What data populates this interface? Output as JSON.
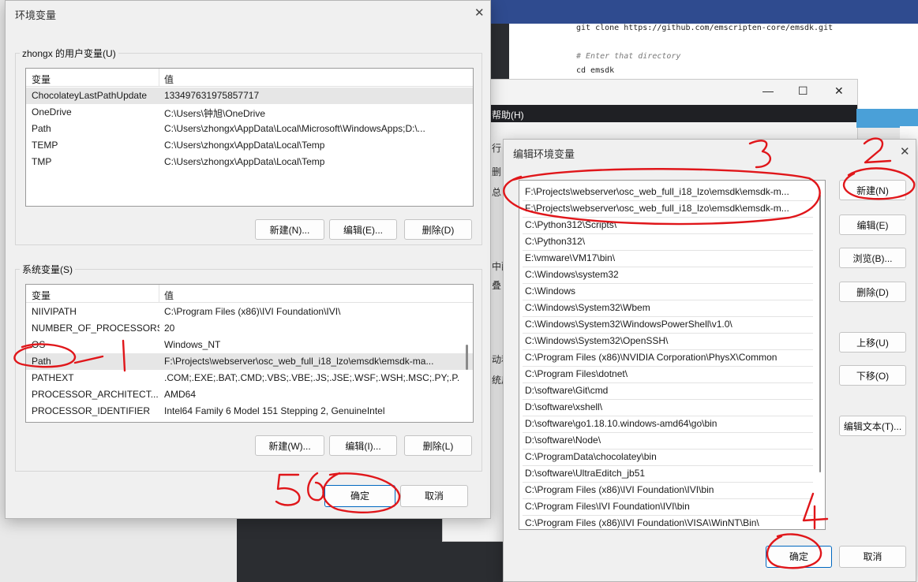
{
  "background": {
    "code_lines": [
      {
        "text": "git clone https://github.com/emscripten-core/emsdk.git",
        "comment": false
      },
      {
        "text": "# Enter that directory",
        "comment": true
      },
      {
        "text": "cd emsdk",
        "comment": false
      }
    ],
    "menu_help": "帮助(H)",
    "side_chips": [
      "行",
      "删",
      "总",
      "中配",
      "叠",
      "动和",
      "统后"
    ]
  },
  "env_dialog": {
    "title": "环境变量",
    "user_group_label": "zhongx 的用户变量(U)",
    "system_group_label": "系统变量(S)",
    "col_variable": "变量",
    "col_value": "值",
    "user_vars": [
      {
        "name": "ChocolateyLastPathUpdate",
        "value": "133497631975857717",
        "selected": true
      },
      {
        "name": "OneDrive",
        "value": "C:\\Users\\钟旭\\OneDrive",
        "selected": false
      },
      {
        "name": "Path",
        "value": "C:\\Users\\zhongx\\AppData\\Local\\Microsoft\\WindowsApps;D:\\...",
        "selected": false
      },
      {
        "name": "TEMP",
        "value": "C:\\Users\\zhongx\\AppData\\Local\\Temp",
        "selected": false
      },
      {
        "name": "TMP",
        "value": "C:\\Users\\zhongx\\AppData\\Local\\Temp",
        "selected": false
      }
    ],
    "system_vars": [
      {
        "name": "NIIVIPATH",
        "value": "C:\\Program Files (x86)\\IVI Foundation\\IVI\\",
        "selected": false
      },
      {
        "name": "NUMBER_OF_PROCESSORS",
        "value": "20",
        "selected": false
      },
      {
        "name": "OS",
        "value": "Windows_NT",
        "selected": false
      },
      {
        "name": "Path",
        "value": "F:\\Projects\\webserver\\osc_web_full_i18_lzo\\emsdk\\emsdk-ma...",
        "selected": true
      },
      {
        "name": "PATHEXT",
        "value": ".COM;.EXE;.BAT;.CMD;.VBS;.VBE;.JS;.JSE;.WSF;.WSH;.MSC;.PY;.P...",
        "selected": false
      },
      {
        "name": "PROCESSOR_ARCHITECT...",
        "value": "AMD64",
        "selected": false
      },
      {
        "name": "PROCESSOR_IDENTIFIER",
        "value": "Intel64 Family 6 Model 151 Stepping 2, GenuineIntel",
        "selected": false
      }
    ],
    "user_buttons": {
      "new": "新建(N)...",
      "edit": "编辑(E)...",
      "delete": "删除(D)"
    },
    "system_buttons": {
      "new": "新建(W)...",
      "edit": "编辑(I)...",
      "delete": "删除(L)"
    },
    "ok": "确定",
    "cancel": "取消"
  },
  "edit_dialog": {
    "title": "编辑环境变量",
    "paths": [
      "F:\\Projects\\webserver\\osc_web_full_i18_lzo\\emsdk\\emsdk-m...",
      "F:\\Projects\\webserver\\osc_web_full_i18_lzo\\emsdk\\emsdk-m...",
      "C:\\Python312\\Scripts\\",
      "C:\\Python312\\",
      "E:\\vmware\\VM17\\bin\\",
      "C:\\Windows\\system32",
      "C:\\Windows",
      "C:\\Windows\\System32\\Wbem",
      "C:\\Windows\\System32\\WindowsPowerShell\\v1.0\\",
      "C:\\Windows\\System32\\OpenSSH\\",
      "C:\\Program Files (x86)\\NVIDIA Corporation\\PhysX\\Common",
      "C:\\Program Files\\dotnet\\",
      "D:\\software\\Git\\cmd",
      "D:\\software\\xshell\\",
      "D:\\software\\go1.18.10.windows-amd64\\go\\bin",
      "D:\\software\\Node\\",
      "C:\\ProgramData\\chocolatey\\bin",
      "D:\\software\\UltraEditch_jb51",
      "C:\\Program Files (x86)\\IVI Foundation\\IVI\\bin",
      "C:\\Program Files\\IVI Foundation\\IVI\\bin",
      "C:\\Program Files (x86)\\IVI Foundation\\VISA\\WinNT\\Bin\\"
    ],
    "buttons": {
      "new": "新建(N)",
      "edit": "编辑(E)",
      "browse": "浏览(B)...",
      "delete": "删除(D)",
      "move_up": "上移(U)",
      "move_down": "下移(O)",
      "edit_text": "编辑文本(T)..."
    },
    "ok": "确定",
    "cancel": "取消"
  },
  "annotations": [
    "1",
    "2",
    "3",
    "4",
    "5"
  ]
}
